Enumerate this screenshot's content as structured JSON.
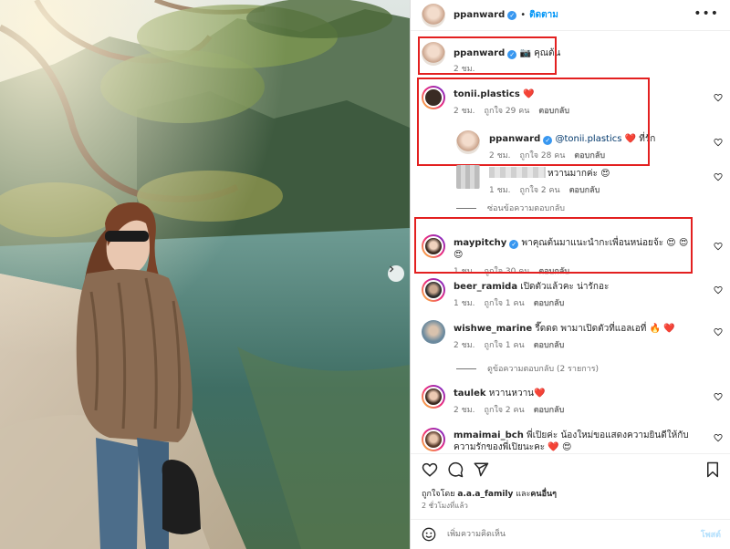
{
  "header": {
    "username": "ppanward",
    "follow_label": "ติดตาม",
    "separator": "•"
  },
  "caption": {
    "username": "ppanward",
    "text": "📷 คุณต้น",
    "time": "2 ชม."
  },
  "comments": [
    {
      "username": "tonii.plastics",
      "text": "❤️",
      "time": "2 ชม.",
      "likes": "ถูกใจ 29 คน",
      "reply_label": "ตอบกลับ",
      "heart_color": "#e0245e"
    },
    {
      "username": "ppanward",
      "mention": "@tonii.plastics",
      "text": "❤️ ที่รัก",
      "time": "2 ชม.",
      "likes": "ถูกใจ 28 คน",
      "reply_label": "ตอบกลับ"
    },
    {
      "username": "",
      "text": "หวานมากค่ะ 😍",
      "time": "1 ชม.",
      "likes": "ถูกใจ 2 คน",
      "reply_label": "ตอบกลับ"
    },
    {
      "username": "maypitchy",
      "text": "พาคุณต้นมาแนะนำกะเพื่อนหน่อยจ้ะ 😍 😍 😍",
      "time": "1 ชม.",
      "likes": "ถูกใจ 30 คน",
      "reply_label": "ตอบกลับ"
    },
    {
      "username": "beer_ramida",
      "text": "เปิดตัวแล้วคะ น่ารักอะ",
      "time": "1 ชม.",
      "likes": "ถูกใจ 1 คน",
      "reply_label": "ตอบกลับ"
    },
    {
      "username": "wishwe_marine",
      "text": "รี๊ดดด พามาเปิดตัวที่แอลเอที่ 🔥 ❤️",
      "time": "2 ชม.",
      "likes": "ถูกใจ 1 คน",
      "reply_label": "ตอบกลับ"
    },
    {
      "username": "taulek",
      "text": "หวานหวาน❤️",
      "time": "2 ชม.",
      "likes": "ถูกใจ 2 คน",
      "reply_label": "ตอบกลับ"
    },
    {
      "username": "mmaimai_bch",
      "text": "พี่เปิยค่ะ น้องใหม่ขอแสดงความยินดีให้กับความรักของพี่เปิยนะคะ ❤️ 😍",
      "time": "",
      "likes": "",
      "reply_label": ""
    }
  ],
  "hide_replies_label": "ซ่อนข้อความตอบกลับ",
  "view_replies_label": "ดูข้อความตอบกลับ (2 รายการ)",
  "footer": {
    "liked_by_prefix": "ถูกใจโดย",
    "liked_by_user": "a.a.a_family",
    "liked_by_and": "และ",
    "liked_by_others": "คนอื่นๆ",
    "post_time": "2 ชั่วโมงที่แล้ว"
  },
  "add_comment": {
    "placeholder": "เพิ่มความคิดเห็น",
    "post_label": "โพสต์"
  },
  "colors": {
    "accent": "#0095f6",
    "highlight_border": "#e32020",
    "verified": "#3897f0",
    "heart": "#e0245e"
  }
}
